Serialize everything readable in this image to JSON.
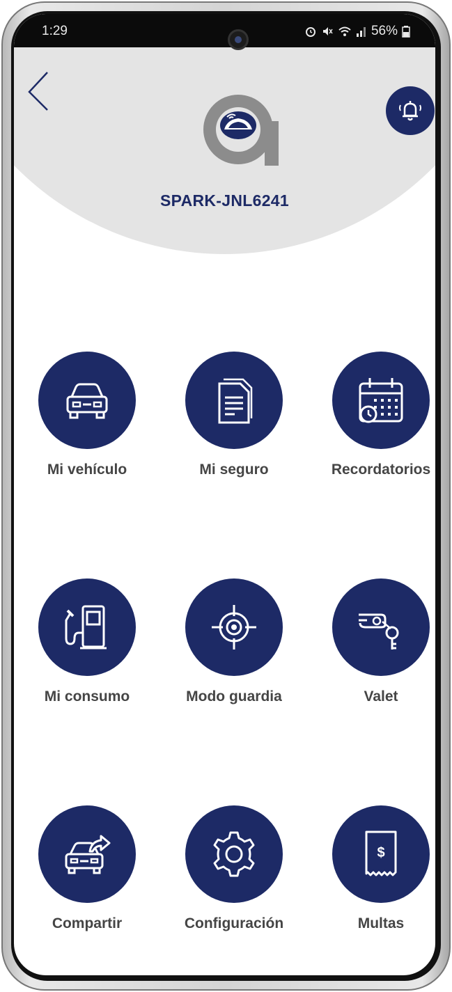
{
  "status_bar": {
    "time": "1:29",
    "battery": "56%"
  },
  "header": {
    "vehicle_name": "SPARK-JNL6241"
  },
  "menu": [
    {
      "label": "Mi vehículo",
      "icon": "car-icon"
    },
    {
      "label": "Mi seguro",
      "icon": "document-icon"
    },
    {
      "label": "Recordatorios",
      "icon": "calendar-icon"
    },
    {
      "label": "Mi consumo",
      "icon": "fuel-pump-icon"
    },
    {
      "label": "Modo guardia",
      "icon": "crosshair-icon"
    },
    {
      "label": "Valet",
      "icon": "hand-key-icon"
    },
    {
      "label": "Compartir",
      "icon": "car-share-icon"
    },
    {
      "label": "Configuración",
      "icon": "gear-icon"
    },
    {
      "label": "Multas",
      "icon": "receipt-dollar-icon"
    }
  ],
  "colors": {
    "primary": "#1d2a66",
    "header_bg": "#e4e4e4",
    "label_text": "#454545"
  }
}
